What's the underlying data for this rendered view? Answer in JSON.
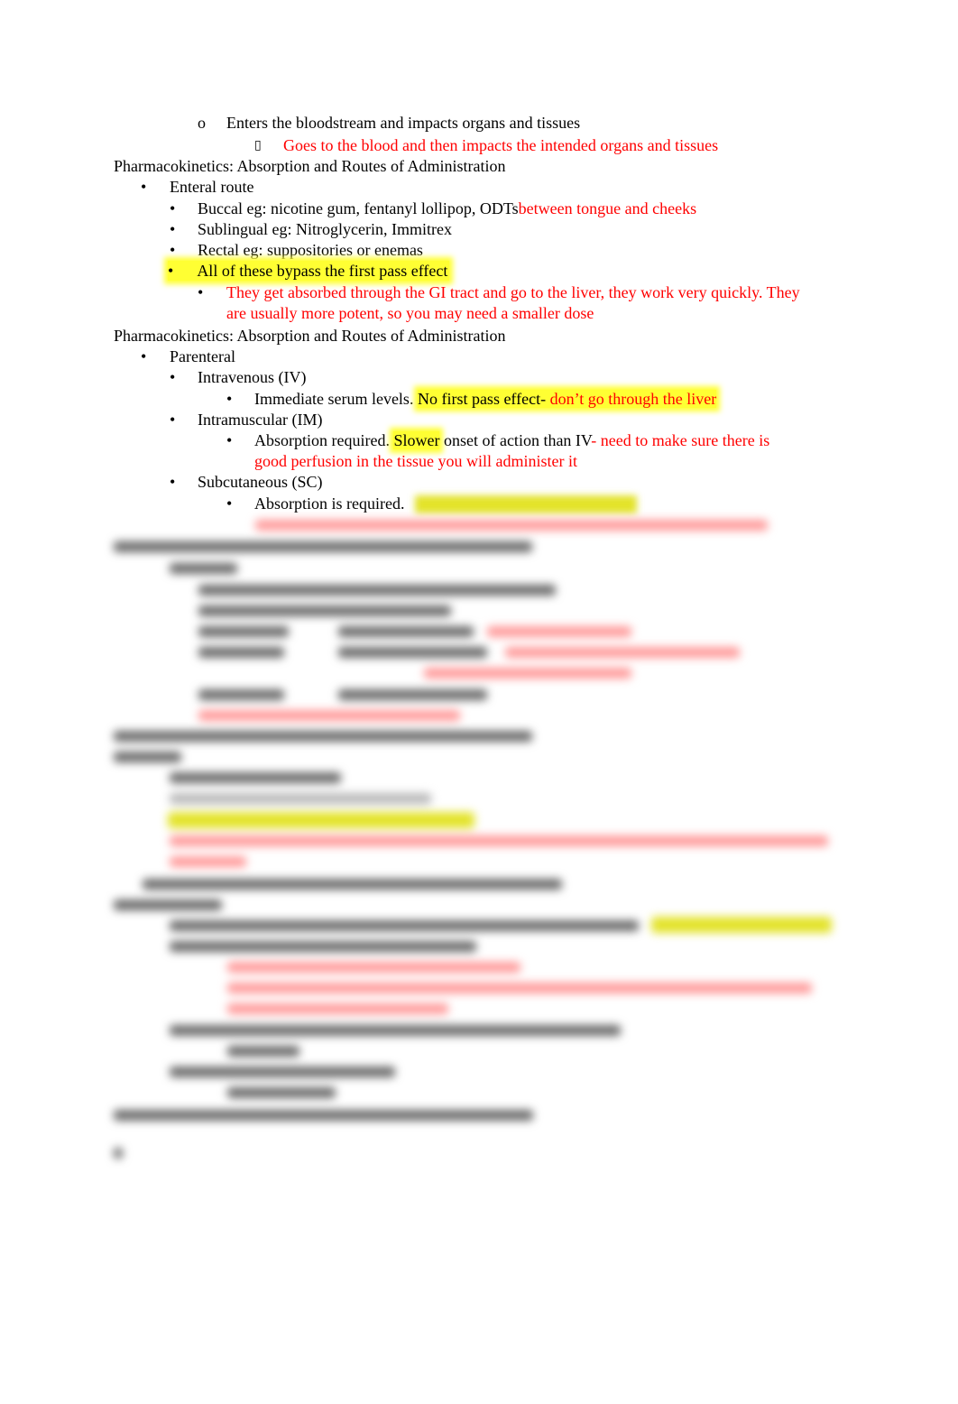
{
  "document": {
    "lines": {
      "l1": {
        "marker": "o",
        "text": "Enters the bloodstream and impacts organs and tissues"
      },
      "l2": {
        "marker": "",
        "text": "Goes to the blood and then impacts the intended organs and tissues"
      },
      "h1": "Pharmacokinetics:  Absorption and Routes of Administration",
      "enteral": {
        "marker": "•",
        "text": "Enteral route"
      },
      "buccal": {
        "text": "Buccal eg: nicotine gum, fentanyl lollipop, ODTs",
        "note": "between tongue and cheeks"
      },
      "sublingual": "Sublingual eg: Nitroglycerin, Immitrex",
      "rectal": "Rectal eg:  suppositories or enemas",
      "bypass": "All of these bypass the first pass effect",
      "absorbed_1": "They get absorbed through the GI tract and go to the liver, they work very quickly. They",
      "absorbed_2": "are usually more potent, so you may need a smaller dose",
      "h2": "Pharmacokinetics:  Absorption and Routes of Administration",
      "parenteral": "Parenteral",
      "iv": "Intravenous (IV)",
      "iv_detail": {
        "text": "Immediate serum levels.  ",
        "highlight": "No first pass effect-",
        "note": " don’t go through the liver"
      },
      "im": "Intramuscular (IM)",
      "im_detail": {
        "text": "Absorption required.  ",
        "highlight": "Slower",
        "text2": " onset of action than IV",
        "note": "- need to make sure there is"
      },
      "im_detail_2": "good perfusion in the tissue you will administer it",
      "sc": "Subcutaneous (SC)",
      "sc_detail": "Absorption is required."
    },
    "bullet": "•",
    "redacted_preview": true
  },
  "colors": {
    "note_red": "#ff0000",
    "highlight_yellow": "#ffff33"
  }
}
